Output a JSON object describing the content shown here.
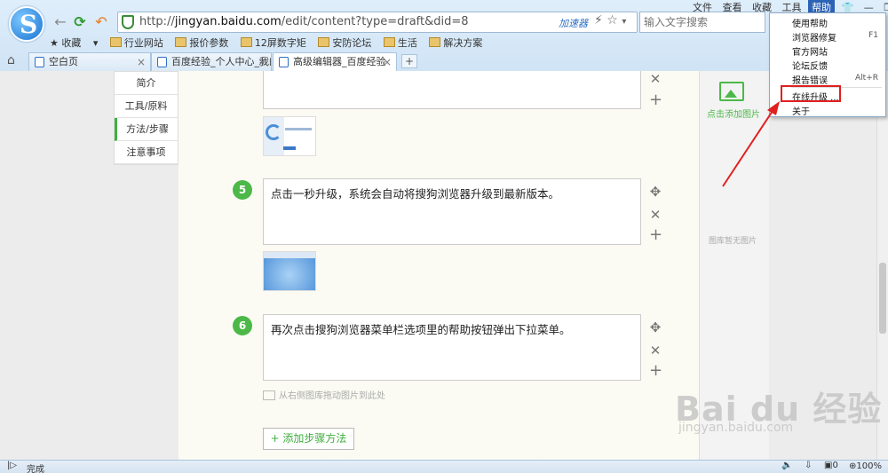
{
  "window": {
    "menus": [
      "文件",
      "查看",
      "收藏",
      "工具",
      "帮助"
    ],
    "window_controls": [
      "shirt-icon",
      "minimize-icon",
      "restore-icon",
      "close-icon"
    ]
  },
  "addressbar": {
    "url_scheme": "http://",
    "url_host": "jingyan.baidu.com",
    "url_path": "/edit/content?type=draft&did=8",
    "accelerator": "加速器",
    "search_placeholder": "输入文字搜索"
  },
  "favorites": [
    "收藏",
    "行业网站",
    "报价参数",
    "12屏数字矩",
    "安防论坛",
    "生活",
    "解决方案"
  ],
  "tabs": [
    {
      "label": "空白页"
    },
    {
      "label": "百度经验_个人中心_我的"
    },
    {
      "label": "高级编辑器_百度经验"
    }
  ],
  "sidenav": [
    "简介",
    "工具/原料",
    "方法/步骤",
    "注意事项"
  ],
  "steps": [
    {
      "num": "5",
      "text": "点击一秒升级，系统会自动将搜狗浏览器升级到最新版本。"
    },
    {
      "num": "6",
      "text": "再次点击搜狗浏览器菜单栏选项里的帮助按钮弹出下拉菜单。"
    }
  ],
  "editor": {
    "drop_hint": "从右侧图库拖动图片到此处",
    "add_step": "+ 添加步骤方法"
  },
  "gallery": {
    "add_picture": "点击添加图片",
    "empty": "图库暂无图片"
  },
  "help_menu": {
    "items": [
      {
        "label": "使用帮助",
        "shortcut": ""
      },
      {
        "label": "浏览器修复",
        "shortcut": "F1"
      },
      {
        "label": "官方网站",
        "shortcut": ""
      },
      {
        "label": "论坛反馈",
        "shortcut": ""
      },
      {
        "label": "报告错误",
        "shortcut": "Alt+R"
      },
      {
        "label": "在线升级 ...",
        "shortcut": ""
      },
      {
        "label": "关于",
        "shortcut": ""
      }
    ]
  },
  "statusbar": {
    "status": "完成",
    "count": "0",
    "zoom": "100%"
  },
  "watermark": {
    "main": "Bai du 经验",
    "sub": "jingyan.baidu.com"
  },
  "colors": {
    "accent_green": "#4cb848",
    "highlight_red": "#e02020",
    "menu_active": "#2c63b5"
  }
}
